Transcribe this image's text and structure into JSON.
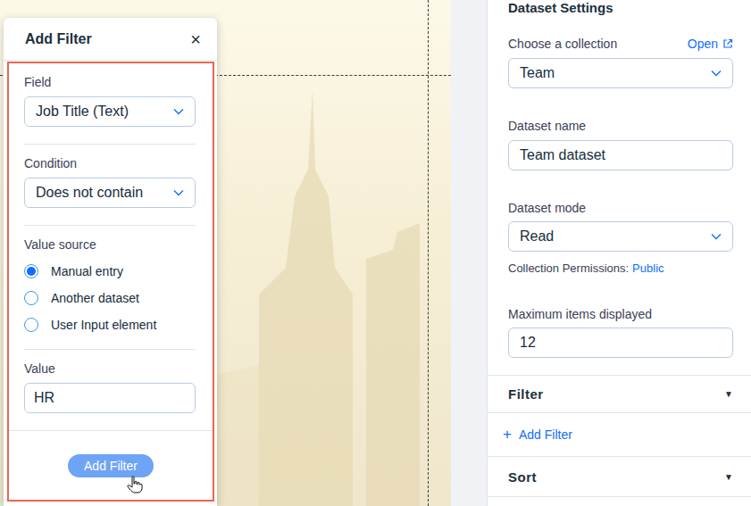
{
  "add_filter": {
    "title": "Add Filter",
    "close": "×",
    "field": {
      "label": "Field",
      "value": "Job Title (Text)"
    },
    "condition": {
      "label": "Condition",
      "value": "Does not contain"
    },
    "value_source": {
      "label": "Value source",
      "options": [
        {
          "label": "Manual entry",
          "selected": true
        },
        {
          "label": "Another dataset",
          "selected": false
        },
        {
          "label": "User Input element",
          "selected": false
        }
      ]
    },
    "value": {
      "label": "Value",
      "value": "HR"
    },
    "submit": "Add Filter"
  },
  "dataset_settings": {
    "title": "Dataset Settings",
    "collection": {
      "label": "Choose a collection",
      "link": "Open",
      "value": "Team"
    },
    "name": {
      "label": "Dataset name",
      "value": "Team dataset"
    },
    "mode": {
      "label": "Dataset mode",
      "value": "Read"
    },
    "permissions": {
      "label": "Collection Permissions:",
      "value": "Public"
    },
    "max_items": {
      "label": "Maximum items displayed",
      "value": "12"
    },
    "filter_section": {
      "label": "Filter",
      "arrow": "▼"
    },
    "add_filter": {
      "icon": "+",
      "label": "Add Filter"
    },
    "sort_section": {
      "label": "Sort",
      "arrow": "▼"
    }
  }
}
